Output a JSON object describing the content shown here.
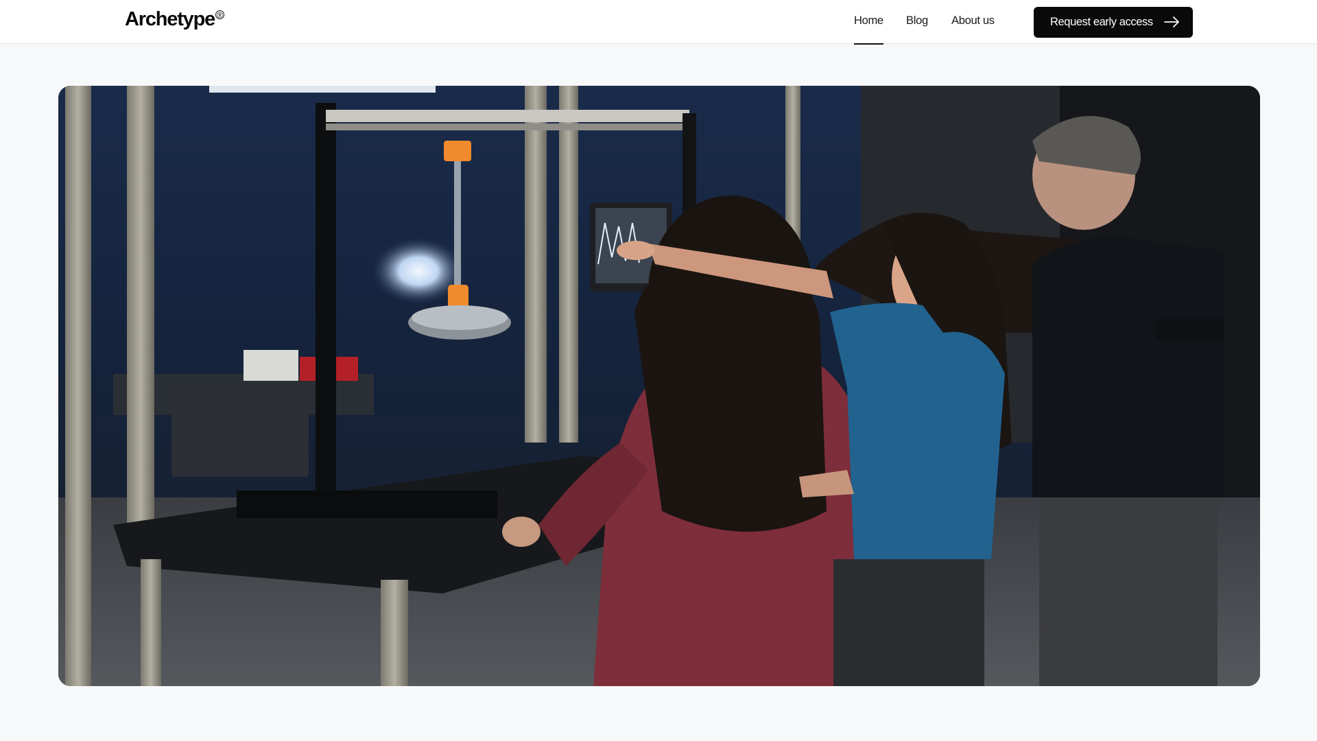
{
  "brand": {
    "name": "Archetype",
    "mark": "®"
  },
  "nav": {
    "items": [
      {
        "label": "Home",
        "active": true
      },
      {
        "label": "Blog",
        "active": false
      },
      {
        "label": "About us",
        "active": false
      }
    ]
  },
  "cta": {
    "label": "Request early access",
    "icon": "arrow-right-icon"
  },
  "hero": {
    "media": "lab-team-video-frame"
  },
  "colors": {
    "background": "#f7f8f9",
    "header": "#ffffff",
    "button": "#0a0a0a",
    "button_text": "#ffffff"
  }
}
